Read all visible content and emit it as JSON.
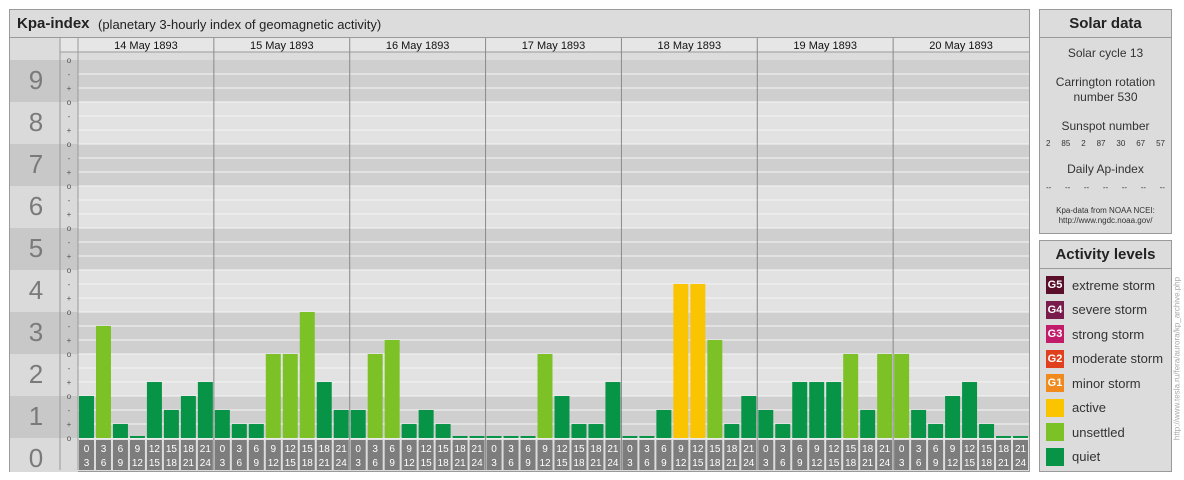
{
  "header": {
    "title": "Kpa-index",
    "subtitle": "(planetary 3-hourly index of geomagnetic activity)"
  },
  "solar": {
    "title": "Solar data",
    "cycle": "Solar cycle 13",
    "carrington_line1": "Carrington rotation",
    "carrington_line2": "number 530",
    "sunspot_title": "Sunspot number",
    "sunspots": [
      "2",
      "85",
      "2",
      "87",
      "30",
      "67",
      "57"
    ],
    "ap_title": "Daily Ap-index",
    "ap_values": [
      "--",
      "--",
      "--",
      "--",
      "--",
      "--",
      "--"
    ],
    "credit_line1": "Kpa-data from NOAA NCEI:",
    "credit_line2": "http://www.ngdc.noaa.gov/"
  },
  "levels": {
    "title": "Activity levels",
    "items": [
      {
        "code": "G5",
        "label": "extreme storm",
        "color": "#5a0e2a"
      },
      {
        "code": "G4",
        "label": "severe storm",
        "color": "#7a1b4d"
      },
      {
        "code": "G3",
        "label": "strong storm",
        "color": "#c21b6a"
      },
      {
        "code": "G2",
        "label": "moderate storm",
        "color": "#e0401d"
      },
      {
        "code": "G1",
        "label": "minor storm",
        "color": "#f08a1c"
      },
      {
        "code": "",
        "label": "active",
        "color": "#fbc400"
      },
      {
        "code": "",
        "label": "unsettled",
        "color": "#7cc227"
      },
      {
        "code": "",
        "label": "quiet",
        "color": "#079447"
      }
    ]
  },
  "watermark": "http://www.tesla.ru/fera/aurora/kp_archive.php",
  "chart_data": {
    "type": "bar",
    "ylim": [
      0,
      9
    ],
    "y_ticks": [
      "0",
      "1",
      "2",
      "3",
      "4",
      "5",
      "6",
      "7",
      "8",
      "9"
    ],
    "minor_tick_labels": [
      "o",
      "+",
      "-"
    ],
    "days": [
      "14 May 1893",
      "15 May 1893",
      "16 May 1893",
      "17 May 1893",
      "18 May 1893",
      "19 May 1893",
      "20 May 1893"
    ],
    "interval_start": [
      "0",
      "3",
      "6",
      "9",
      "12",
      "15",
      "18",
      "21"
    ],
    "interval_end": [
      "3",
      "6",
      "9",
      "12",
      "15",
      "18",
      "21",
      "24"
    ],
    "values": [
      [
        1.0,
        2.667,
        0.333,
        0.0,
        1.333,
        0.667,
        1.0,
        1.333
      ],
      [
        0.667,
        0.333,
        0.333,
        2.0,
        2.0,
        3.0,
        1.333,
        0.667
      ],
      [
        0.667,
        2.0,
        2.333,
        0.333,
        0.667,
        0.333,
        0.0,
        0.0
      ],
      [
        0.0,
        0.0,
        0.0,
        2.0,
        1.0,
        0.333,
        0.333,
        1.333
      ],
      [
        0.0,
        0.0,
        0.667,
        3.667,
        3.667,
        2.333,
        0.333,
        1.0
      ],
      [
        0.667,
        0.333,
        1.333,
        1.333,
        1.333,
        2.0,
        0.667,
        2.0
      ],
      [
        2.0,
        0.667,
        0.333,
        1.0,
        1.333,
        0.333,
        0.0,
        0.0
      ]
    ],
    "level_colors": {
      "quiet": "#079447",
      "unsettled": "#7cc227",
      "active": "#fbc400"
    }
  }
}
